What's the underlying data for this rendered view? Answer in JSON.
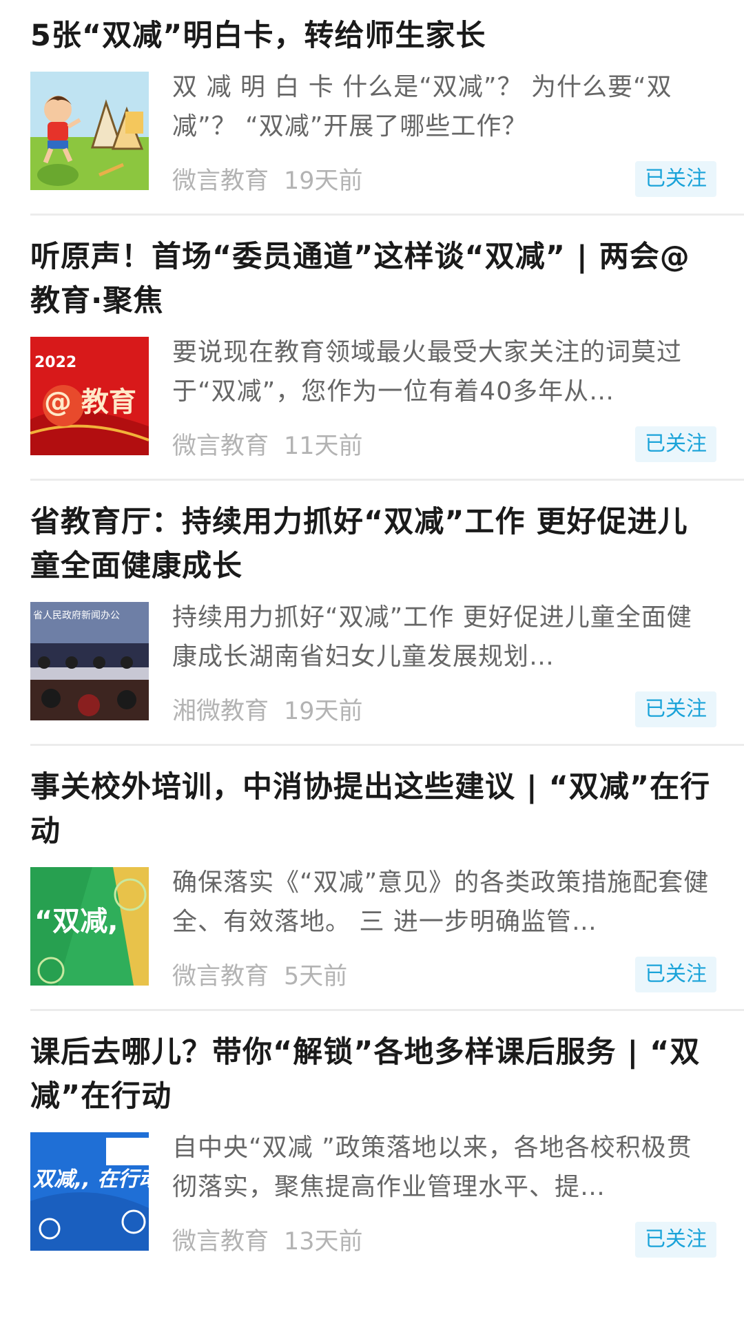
{
  "articles": [
    {
      "title": "5张“双减”明白卡，转给师生家长",
      "summary": "双 减 明 白 卡 什么是“双减”？ 为什么要“双减”？ “双减”开展了哪些工作？",
      "source": "微言教育",
      "time": "19天前",
      "follow_label": "已关注",
      "thumb_icon": "cartoon-boy-with-books-icon"
    },
    {
      "title": "听原声！首场“委员通道”这样谈“双减” | 两会@教育·聚焦",
      "summary": "要说现在教育领域最火最受大家关注的词莫过于“双减”，您作为一位有着40多年从…",
      "source": "微言教育",
      "time": "11天前",
      "follow_label": "已关注",
      "thumb_text_year": "2022",
      "thumb_text_main": "@ 教育"
    },
    {
      "title": "省教育厅：持续用力抓好“双减”工作 更好促进儿童全面健康成长",
      "summary": "持续用力抓好“双减”工作 更好促进儿童全面健康成长湖南省妇女儿童发展规划…",
      "source": "湘微教育",
      "time": "19天前",
      "follow_label": "已关注",
      "thumb_icon": "press-conference-photo-icon",
      "thumb_banner": "省人民政府新闻办公"
    },
    {
      "title": "事关校外培训，中消协提出这些建议 | “双减”在行动",
      "summary": "确保落实《“双减”意见》的各类政策措施配套健全、有效落地。 三 进一步明确监管…",
      "source": "微言教育",
      "time": "5天前",
      "follow_label": "已关注",
      "thumb_text_main": "“双减,"
    },
    {
      "title": "课后去哪儿？带你“解锁”各地多样课后服务 | “双减”在行动",
      "summary": "自中央“双减 ”政策落地以来，各地各校积极贯彻落实，聚焦提高作业管理水平、提…",
      "source": "微言教育",
      "time": "13天前",
      "follow_label": "已关注",
      "thumb_text_main": "双减,, 在行动"
    }
  ],
  "colors": {
    "title": "#1a1a1a",
    "summary": "#666666",
    "meta": "#b3b3b3",
    "follow_text": "#1aa3d9",
    "follow_bg": "#eaf6fc",
    "divider": "#ececec"
  }
}
